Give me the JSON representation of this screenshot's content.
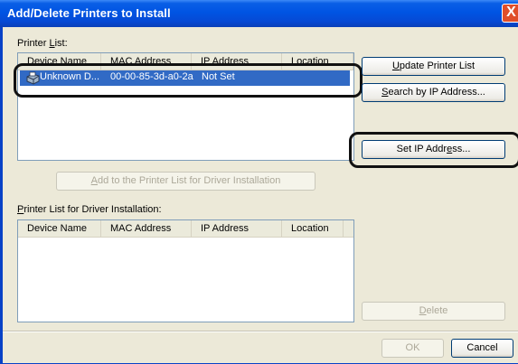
{
  "window": {
    "title": "Add/Delete Printers to Install",
    "close_glyph": "X"
  },
  "printer_list": {
    "label_pre": "Printer ",
    "label_mnemonic": "L",
    "label_post": "ist:",
    "columns": [
      "Device Name",
      "MAC Address",
      "IP Address",
      "Location"
    ],
    "rows": [
      {
        "device_name": "Unknown D...",
        "mac_address": "00-00-85-3d-a0-2a",
        "ip_address": "Not Set",
        "location": ""
      }
    ]
  },
  "buttons": {
    "update_pre": "",
    "update_mnemonic": "U",
    "update_post": "pdate Printer List",
    "search_pre": "",
    "search_mnemonic": "S",
    "search_post": "earch by IP Address...",
    "set_ip_pre": "Set IP Addr",
    "set_ip_mnemonic": "e",
    "set_ip_post": "ss...",
    "add_pre": "",
    "add_mnemonic": "A",
    "add_post": "dd to the Printer List for Driver Installation",
    "delete_pre": "",
    "delete_mnemonic": "D",
    "delete_post": "elete",
    "ok": "OK",
    "cancel": "Cancel"
  },
  "install_list": {
    "label_pre": "",
    "label_mnemonic": "P",
    "label_post": "rinter List for Driver Installation:",
    "columns": [
      "Device Name",
      "MAC Address",
      "IP Address",
      "Location"
    ]
  }
}
